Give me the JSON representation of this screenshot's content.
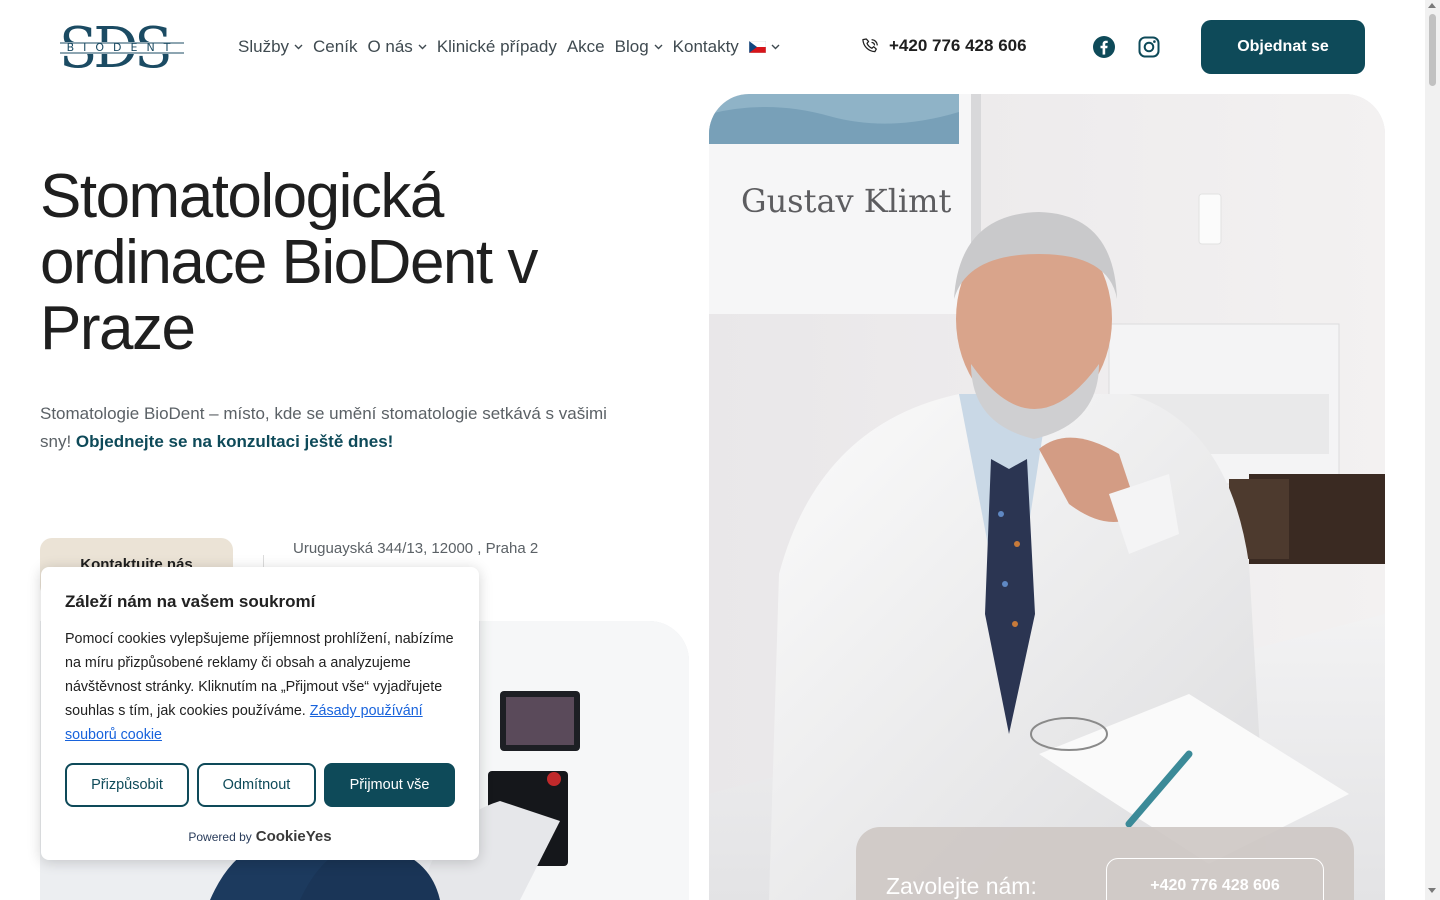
{
  "header": {
    "logo_text": "BIODENT",
    "nav": [
      {
        "label": "Služby",
        "has_dropdown": true
      },
      {
        "label": "Ceník",
        "has_dropdown": false
      },
      {
        "label": "O nás",
        "has_dropdown": true
      },
      {
        "label": "Klinické případy",
        "has_dropdown": false
      },
      {
        "label": "Akce",
        "has_dropdown": false
      },
      {
        "label": "Blog",
        "has_dropdown": true
      },
      {
        "label": "Kontakty",
        "has_dropdown": false
      }
    ],
    "language_flag": "czech-flag-icon",
    "phone": "+420 776 428 606",
    "book_button": "Objednat se"
  },
  "hero": {
    "title": "Stomatologická ordinace BioDent v Praze",
    "subtitle": "Stomatologie BioDent – místo, kde se umění stomatologie setkává s vašimi sny!",
    "subtitle_cta": "Objednejte se na konzultaci ještě dnes!",
    "contact_button": "Kontaktujte nás",
    "address": "Uruguayská 344/13, 12000 , Praha 2"
  },
  "photo": {
    "wall_text": "Gustav Klimt"
  },
  "call_card": {
    "label": "Zavolejte nám:",
    "phone": "+420 776 428 606"
  },
  "cookie": {
    "title": "Záleží nám na vašem soukromí",
    "text": "Pomocí cookies vylepšujeme příjemnost prohlížení, nabízíme na míru přizpůsobené reklamy či obsah a analyzujeme návštěvnost stránky. Kliknutím na „Přijmout vše“ vyjadřujete souhlas s tím, jak cookies používáme.",
    "link": "Zásady používání souborů cookie",
    "customize": "Přizpůsobit",
    "reject": "Odmítnout",
    "accept": "Přijmout vše",
    "powered_by": "Powered by",
    "brand": "CookieYes"
  },
  "colors": {
    "primary": "#0e4a59",
    "beige": "#ebe3d6",
    "link": "#1863dc"
  }
}
